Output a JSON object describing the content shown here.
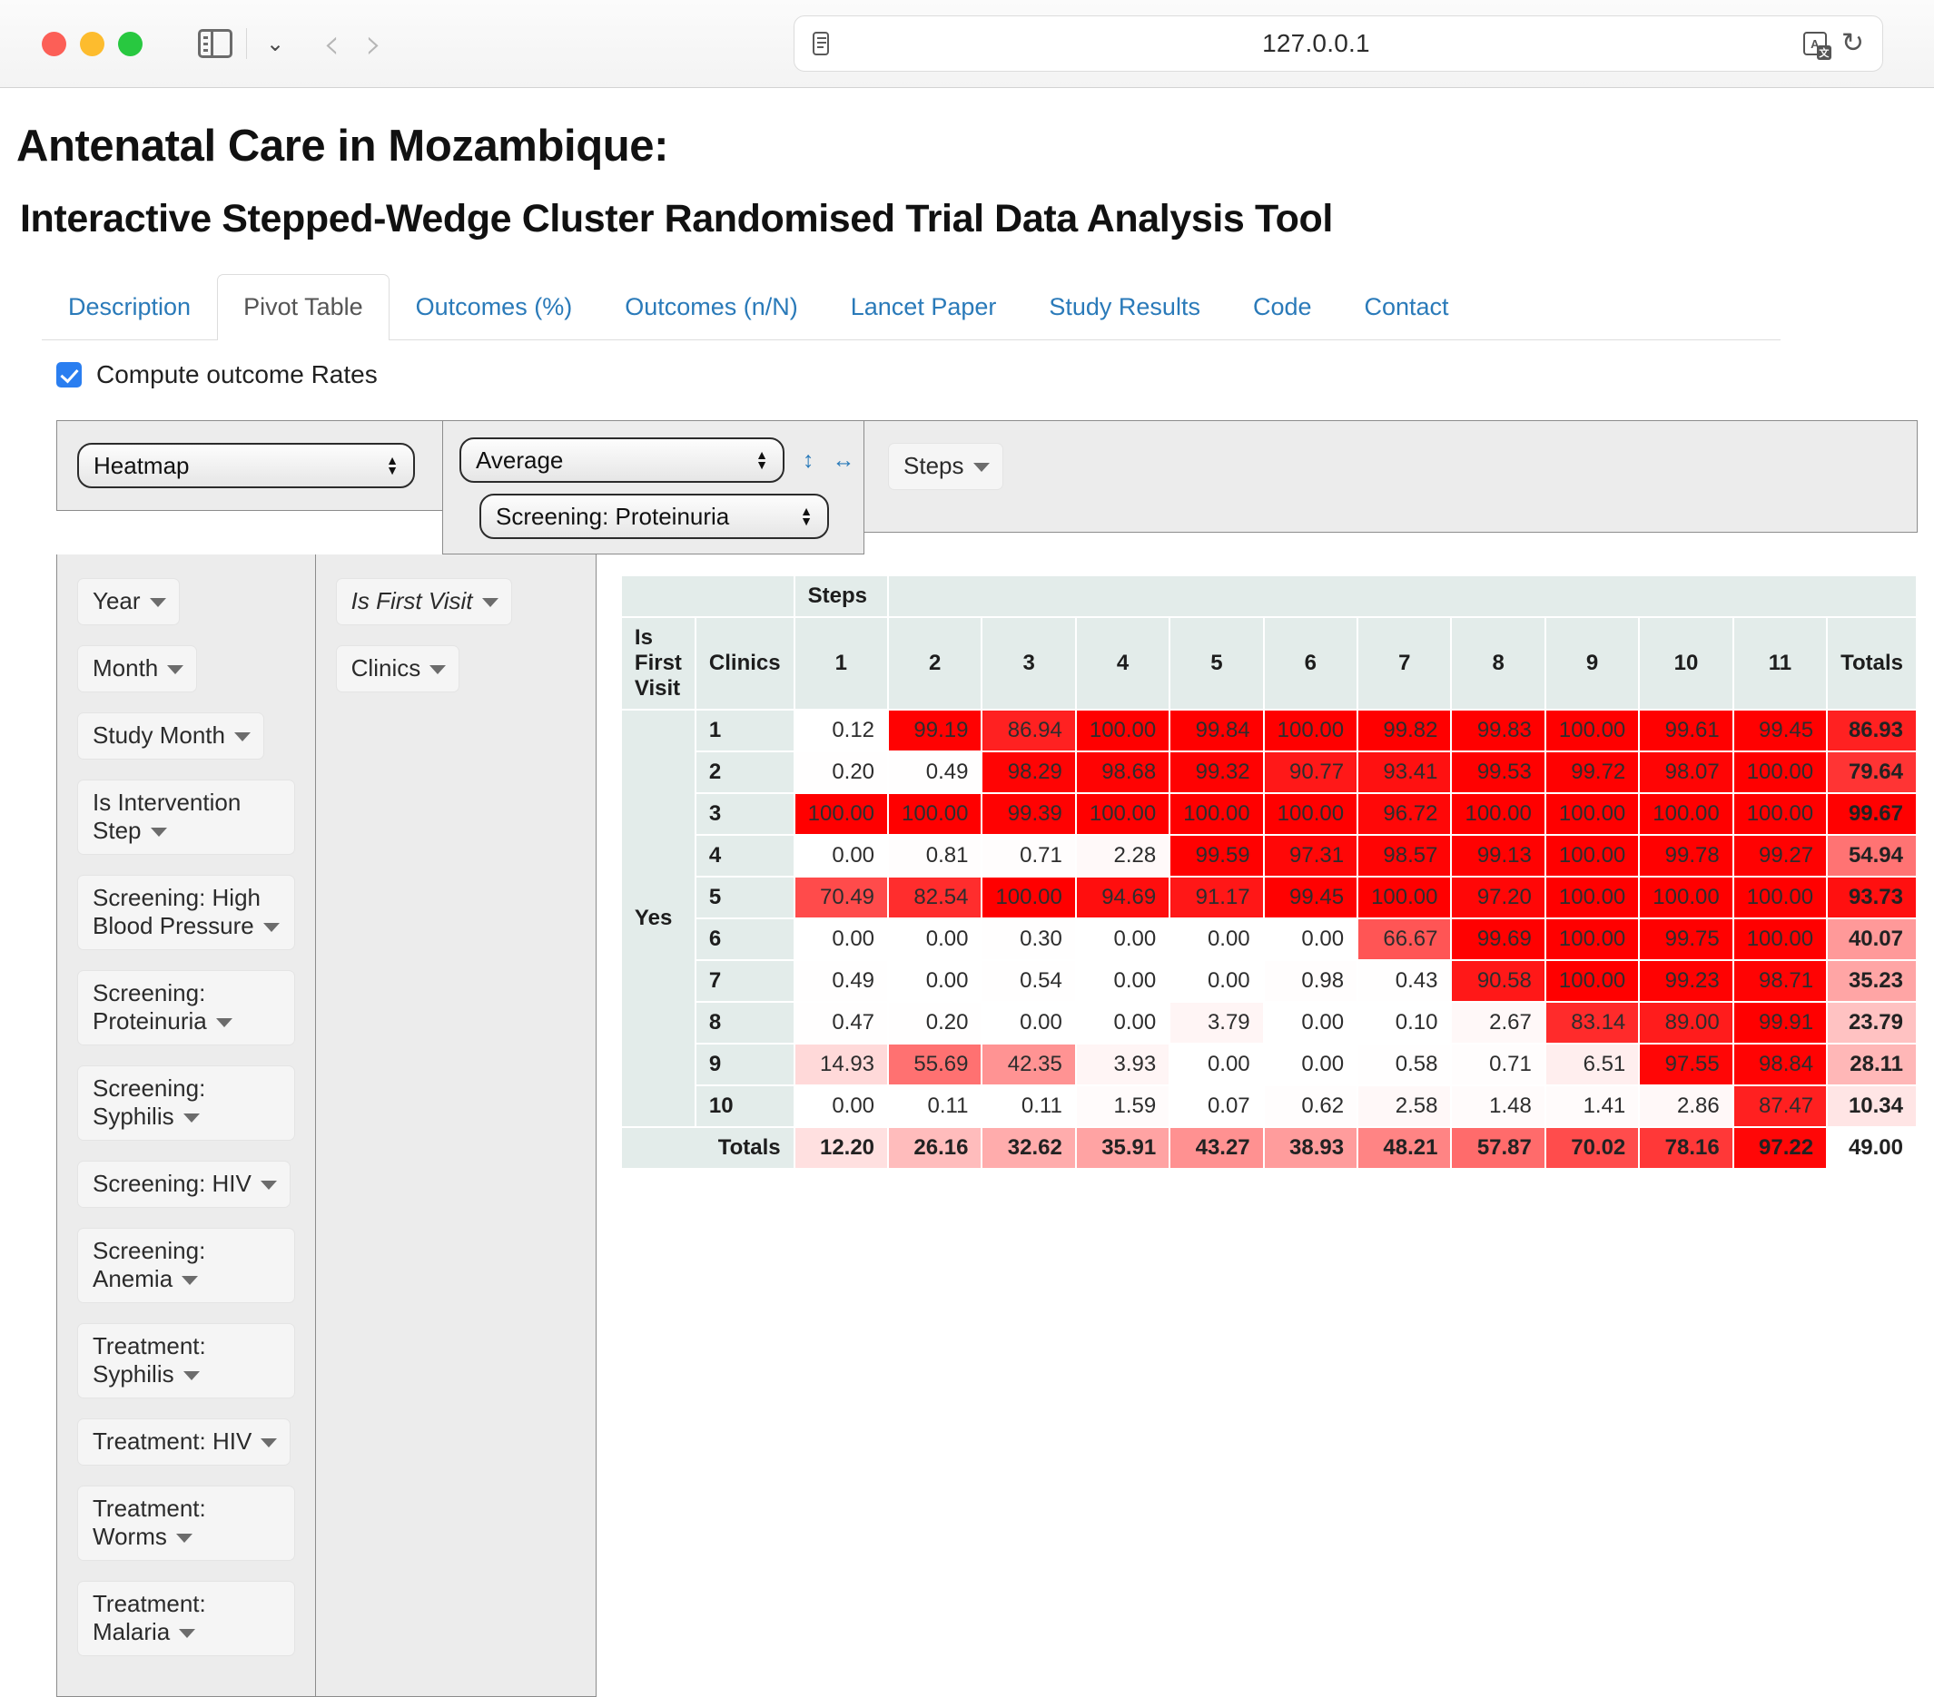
{
  "browser": {
    "url": "127.0.0.1",
    "sidebar_icon": "sidebar-icon",
    "chevron_icon": "chevron-down-icon",
    "back_icon": "‹",
    "forward_icon": "›",
    "reader_icon": "reader-view-icon",
    "translate_icon": "translate-icon",
    "reload_icon": "↻"
  },
  "page": {
    "title": "Antenatal Care in Mozambique:",
    "subtitle": "Interactive Stepped-Wedge Cluster Randomised Trial Data Analysis Tool"
  },
  "tabs": [
    {
      "label": "Description",
      "active": false
    },
    {
      "label": "Pivot Table",
      "active": true
    },
    {
      "label": "Outcomes (%)",
      "active": false
    },
    {
      "label": "Outcomes (n/N)",
      "active": false
    },
    {
      "label": "Lancet Paper",
      "active": false
    },
    {
      "label": "Study Results",
      "active": false
    },
    {
      "label": "Code",
      "active": false
    },
    {
      "label": "Contact",
      "active": false
    }
  ],
  "options": {
    "compute_rates_label": "Compute outcome Rates",
    "compute_rates_checked": true
  },
  "controls": {
    "renderer_value": "Heatmap",
    "aggregator_value": "Average",
    "attribute_value": "Screening: Proteinuria",
    "vertical_resize_icon": "↕",
    "horizontal_resize_icon": "↔"
  },
  "unused_fields": [
    "Year",
    "Month",
    "Study Month",
    "Is Intervention Step",
    "Screening: High Blood Pressure",
    "Screening: Proteinuria",
    "Screening: Syphilis",
    "Screening: HIV",
    "Screening: Anemia",
    "Treatment: Syphilis",
    "Treatment: HIV",
    "Treatment: Worms",
    "Treatment: Malaria"
  ],
  "row_fields": [
    {
      "label": "Is First Visit",
      "italic": true
    },
    {
      "label": "Clinics",
      "italic": false
    }
  ],
  "col_fields": [
    {
      "label": "Steps",
      "italic": false
    }
  ],
  "chart_data": {
    "type": "heatmap",
    "title": "Average of Screening: Proteinuria",
    "col_axis_label": "Steps",
    "row_axis_labels": [
      "Is First Visit",
      "Clinics"
    ],
    "categories": [
      "1",
      "2",
      "3",
      "4",
      "5",
      "6",
      "7",
      "8",
      "9",
      "10",
      "11"
    ],
    "totals_label": "Totals",
    "row_group_label": "Yes",
    "rows": [
      {
        "clinic": "1",
        "values": [
          0.12,
          99.19,
          86.94,
          100.0,
          99.84,
          100.0,
          99.82,
          99.83,
          100.0,
          99.61,
          99.45
        ],
        "total": 86.93
      },
      {
        "clinic": "2",
        "values": [
          0.2,
          0.49,
          98.29,
          98.68,
          99.32,
          90.77,
          93.41,
          99.53,
          99.72,
          98.07,
          100.0
        ],
        "total": 79.64
      },
      {
        "clinic": "3",
        "values": [
          100.0,
          100.0,
          99.39,
          100.0,
          100.0,
          100.0,
          96.72,
          100.0,
          100.0,
          100.0,
          100.0
        ],
        "total": 99.67
      },
      {
        "clinic": "4",
        "values": [
          0.0,
          0.81,
          0.71,
          2.28,
          99.59,
          97.31,
          98.57,
          99.13,
          100.0,
          99.78,
          99.27
        ],
        "total": 54.94
      },
      {
        "clinic": "5",
        "values": [
          70.49,
          82.54,
          100.0,
          94.69,
          91.17,
          99.45,
          100.0,
          97.2,
          100.0,
          100.0,
          100.0
        ],
        "total": 93.73
      },
      {
        "clinic": "6",
        "values": [
          0.0,
          0.0,
          0.3,
          0.0,
          0.0,
          0.0,
          66.67,
          99.69,
          100.0,
          99.75,
          100.0
        ],
        "total": 40.07
      },
      {
        "clinic": "7",
        "values": [
          0.49,
          0.0,
          0.54,
          0.0,
          0.0,
          0.98,
          0.43,
          90.58,
          100.0,
          99.23,
          98.71
        ],
        "total": 35.23
      },
      {
        "clinic": "8",
        "values": [
          0.47,
          0.2,
          0.0,
          0.0,
          3.79,
          0.0,
          0.1,
          2.67,
          83.14,
          89.0,
          99.91
        ],
        "total": 23.79
      },
      {
        "clinic": "9",
        "values": [
          14.93,
          55.69,
          42.35,
          3.93,
          0.0,
          0.0,
          0.58,
          0.71,
          6.51,
          97.55,
          98.84
        ],
        "total": 28.11
      },
      {
        "clinic": "10",
        "values": [
          0.0,
          0.11,
          0.11,
          1.59,
          0.07,
          0.62,
          2.58,
          1.48,
          1.41,
          2.86,
          87.47
        ],
        "total": 10.34
      }
    ],
    "column_totals": [
      12.2,
      26.16,
      32.62,
      35.91,
      43.27,
      38.93,
      48.21,
      57.87,
      70.02,
      78.16,
      97.22
    ],
    "grand_total": 49.0,
    "colorscale": {
      "low": "#ffffff",
      "high": "#ff0000",
      "min": 0,
      "max": 100
    }
  }
}
